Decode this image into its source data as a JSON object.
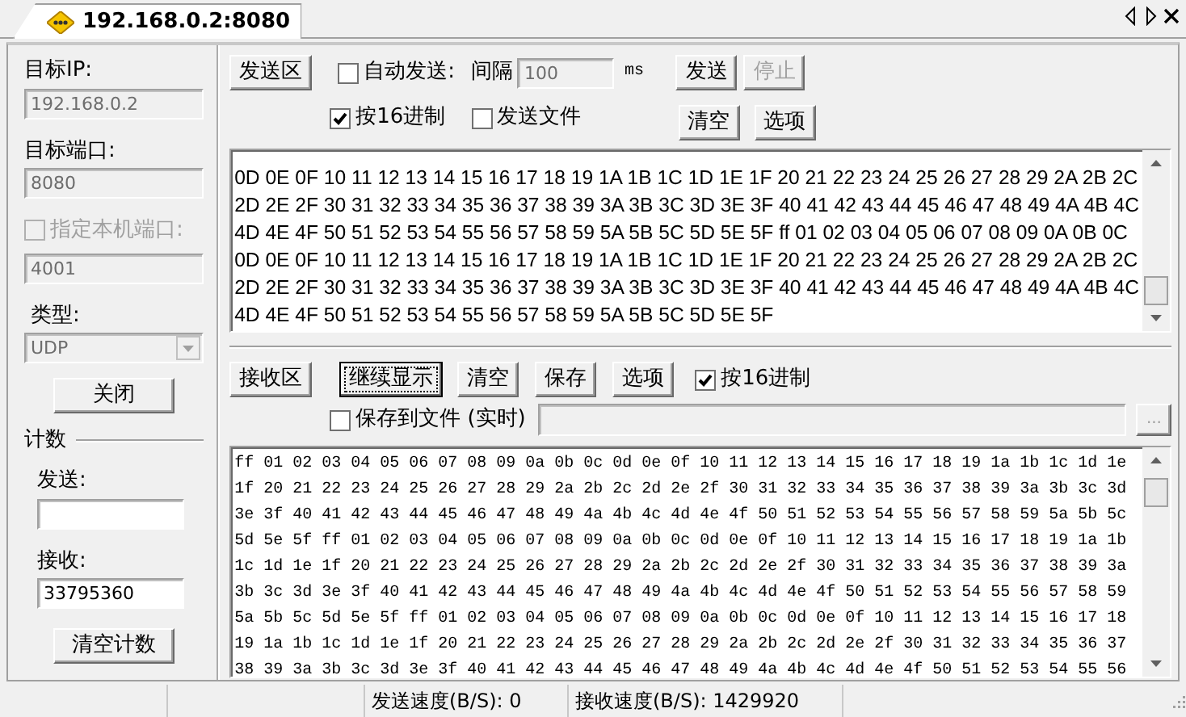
{
  "tab": {
    "title": "192.168.0.2:8080",
    "selected": true
  },
  "connection": {
    "target_ip": {
      "label": "目标IP:",
      "value": "192.168.0.2",
      "disabled": true
    },
    "target_port": {
      "label": "目标端口:",
      "value": "8080",
      "disabled": true
    },
    "local_port": {
      "label": "指定本机端口:",
      "checked": false,
      "disabled": true,
      "value": "4001"
    },
    "type": {
      "label": "类型:",
      "value": "UDP",
      "disabled": true
    },
    "close_button": "关闭"
  },
  "counter": {
    "title": "计数",
    "send_label": "发送:",
    "receive_label": "接收:",
    "receive_value": "33795360",
    "clear_button": "清空计数"
  },
  "send_area": {
    "area_button": "发送区",
    "auto_send": {
      "label": "自动发送:",
      "checked": false
    },
    "interval_label": "间隔",
    "interval": {
      "value": "100",
      "disabled": true
    },
    "interval_unit": "ms",
    "send_button": {
      "label": "发送",
      "disabled": false
    },
    "stop_button": {
      "label": "停止",
      "disabled": true
    },
    "hex": {
      "label": "按16进制",
      "checked": true
    },
    "send_file": {
      "label": "发送文件",
      "checked": false
    },
    "clear_button": "清空",
    "options_button": "选项",
    "lines": [
      "0D 0E 0F 10 11 12 13 14 15 16 17 18 19 1A 1B 1C 1D 1E 1F 20 21 22 23 24 25 26 27 28 29 2A 2B 2C",
      "2D 2E 2F 30 31 32 33 34 35 36 37 38 39 3A 3B 3C 3D 3E 3F 40 41 42 43 44 45 46 47 48 49 4A 4B 4C",
      "4D 4E 4F 50 51 52 53 54 55 56 57 58 59 5A 5B 5C 5D 5E 5F ff 01 02 03 04 05 06 07 08 09 0A 0B 0C",
      "0D 0E 0F 10 11 12 13 14 15 16 17 18 19 1A 1B 1C 1D 1E 1F 20 21 22 23 24 25 26 27 28 29 2A 2B 2C",
      "2D 2E 2F 30 31 32 33 34 35 36 37 38 39 3A 3B 3C 3D 3E 3F 40 41 42 43 44 45 46 47 48 49 4A 4B 4C",
      "4D 4E 4F 50 51 52 53 54 55 56 57 58 59 5A 5B 5C 5D 5E 5F"
    ]
  },
  "receive_area": {
    "area_button": "接收区",
    "continue_button": "继续显示",
    "clear_button": "清空",
    "save_button": "保存",
    "options_button": "选项",
    "hex": {
      "label": "按16进制",
      "checked": true
    },
    "save_to_file": {
      "label": "保存到文件 (实时)",
      "checked": false
    },
    "browse_button": {
      "label": "...",
      "disabled": true
    },
    "lines": [
      "ff 01 02 03 04 05 06 07 08 09 0a 0b 0c 0d 0e 0f 10 11 12 13 14 15 16 17 18 19 1a 1b 1c 1d 1e",
      "1f 20 21 22 23 24 25 26 27 28 29 2a 2b 2c 2d 2e 2f 30 31 32 33 34 35 36 37 38 39 3a 3b 3c 3d",
      "3e 3f 40 41 42 43 44 45 46 47 48 49 4a 4b 4c 4d 4e 4f 50 51 52 53 54 55 56 57 58 59 5a 5b 5c",
      "5d 5e 5f ff 01 02 03 04 05 06 07 08 09 0a 0b 0c 0d 0e 0f 10 11 12 13 14 15 16 17 18 19 1a 1b",
      "1c 1d 1e 1f 20 21 22 23 24 25 26 27 28 29 2a 2b 2c 2d 2e 2f 30 31 32 33 34 35 36 37 38 39 3a",
      "3b 3c 3d 3e 3f 40 41 42 43 44 45 46 47 48 49 4a 4b 4c 4d 4e 4f 50 51 52 53 54 55 56 57 58 59",
      "5a 5b 5c 5d 5e 5f ff 01 02 03 04 05 06 07 08 09 0a 0b 0c 0d 0e 0f 10 11 12 13 14 15 16 17 18",
      "19 1a 1b 1c 1d 1e 1f 20 21 22 23 24 25 26 27 28 29 2a 2b 2c 2d 2e 2f 30 31 32 33 34 35 36 37",
      "38 39 3a 3b 3c 3d 3e 3f 40 41 42 43 44 45 46 47 48 49 4a 4b 4c 4d 4e 4f 50 51 52 53 54 55 56"
    ]
  },
  "status_bar": {
    "send_speed": "发送速度(B/S): 0",
    "receive_speed": "接收速度(B/S): 1429920"
  }
}
